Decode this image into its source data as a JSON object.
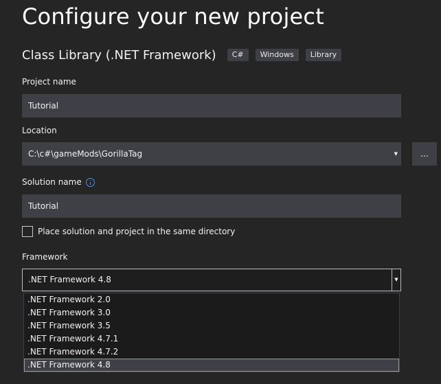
{
  "header": {
    "title": "Configure your new project"
  },
  "template": {
    "name": "Class Library (.NET Framework)",
    "tags": [
      "C#",
      "Windows",
      "Library"
    ]
  },
  "project_name": {
    "label": "Project name",
    "value": "Tutorial"
  },
  "location": {
    "label": "Location",
    "value": "C:\\c#\\gameMods\\GorillaTag",
    "browse_label": "..."
  },
  "solution_name": {
    "label": "Solution name",
    "value": "Tutorial",
    "info_icon": "info-icon"
  },
  "same_directory": {
    "label": "Place solution and project in the same directory",
    "checked": false
  },
  "framework": {
    "label": "Framework",
    "selected": ".NET Framework 4.8",
    "options": [
      ".NET Framework 2.0",
      ".NET Framework 3.0",
      ".NET Framework 3.5",
      ".NET Framework 4.7.1",
      ".NET Framework 4.7.2",
      ".NET Framework 4.8"
    ],
    "highlighted_index": 5
  },
  "colors": {
    "background": "#252526",
    "field": "#3f3f46",
    "accent_info": "#3794ff"
  }
}
